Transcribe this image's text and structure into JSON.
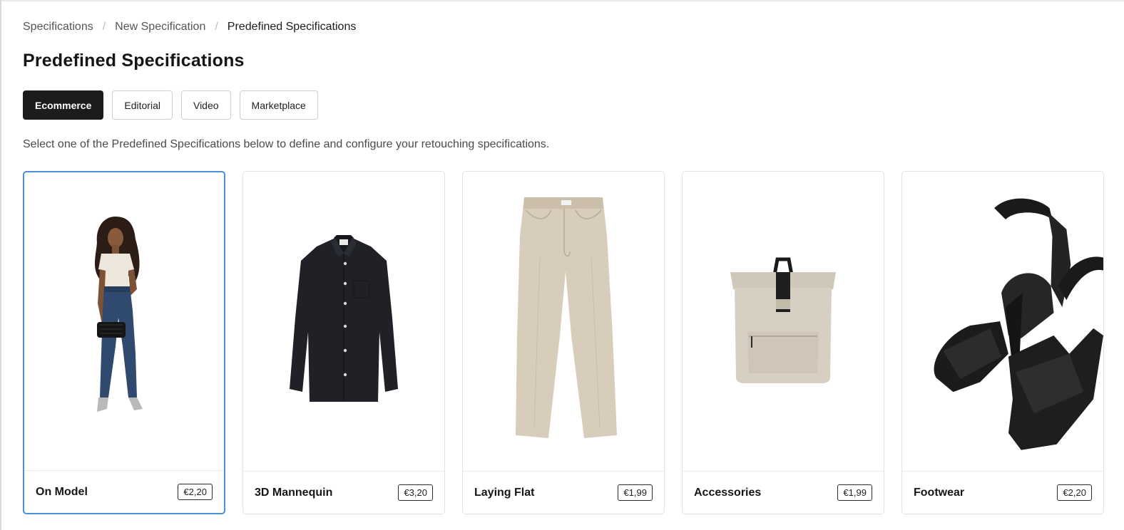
{
  "breadcrumb": {
    "items": [
      "Specifications",
      "New Specification",
      "Predefined Specifications"
    ],
    "separator": "/"
  },
  "page_title": "Predefined Specifications",
  "tabs": [
    {
      "label": "Ecommerce",
      "active": true
    },
    {
      "label": "Editorial",
      "active": false
    },
    {
      "label": "Video",
      "active": false
    },
    {
      "label": "Marketplace",
      "active": false
    }
  ],
  "description": "Select one of the Predefined Specifications below to define and configure your retouching specifications.",
  "cards": [
    {
      "title": "On Model",
      "price": "€2,20",
      "selected": true,
      "image": "model-in-jeans"
    },
    {
      "title": "3D Mannequin",
      "price": "€3,20",
      "selected": false,
      "image": "black-shirt"
    },
    {
      "title": "Laying Flat",
      "price": "€1,99",
      "selected": false,
      "image": "beige-jeans"
    },
    {
      "title": "Accessories",
      "price": "€1,99",
      "selected": false,
      "image": "beige-backpack"
    },
    {
      "title": "Footwear",
      "price": "€2,20",
      "selected": false,
      "image": "black-sandals"
    }
  ],
  "colors": {
    "active_tab": "#1c1c1c",
    "selected_border": "#4a8fd9",
    "text": "#1f1f1f"
  }
}
